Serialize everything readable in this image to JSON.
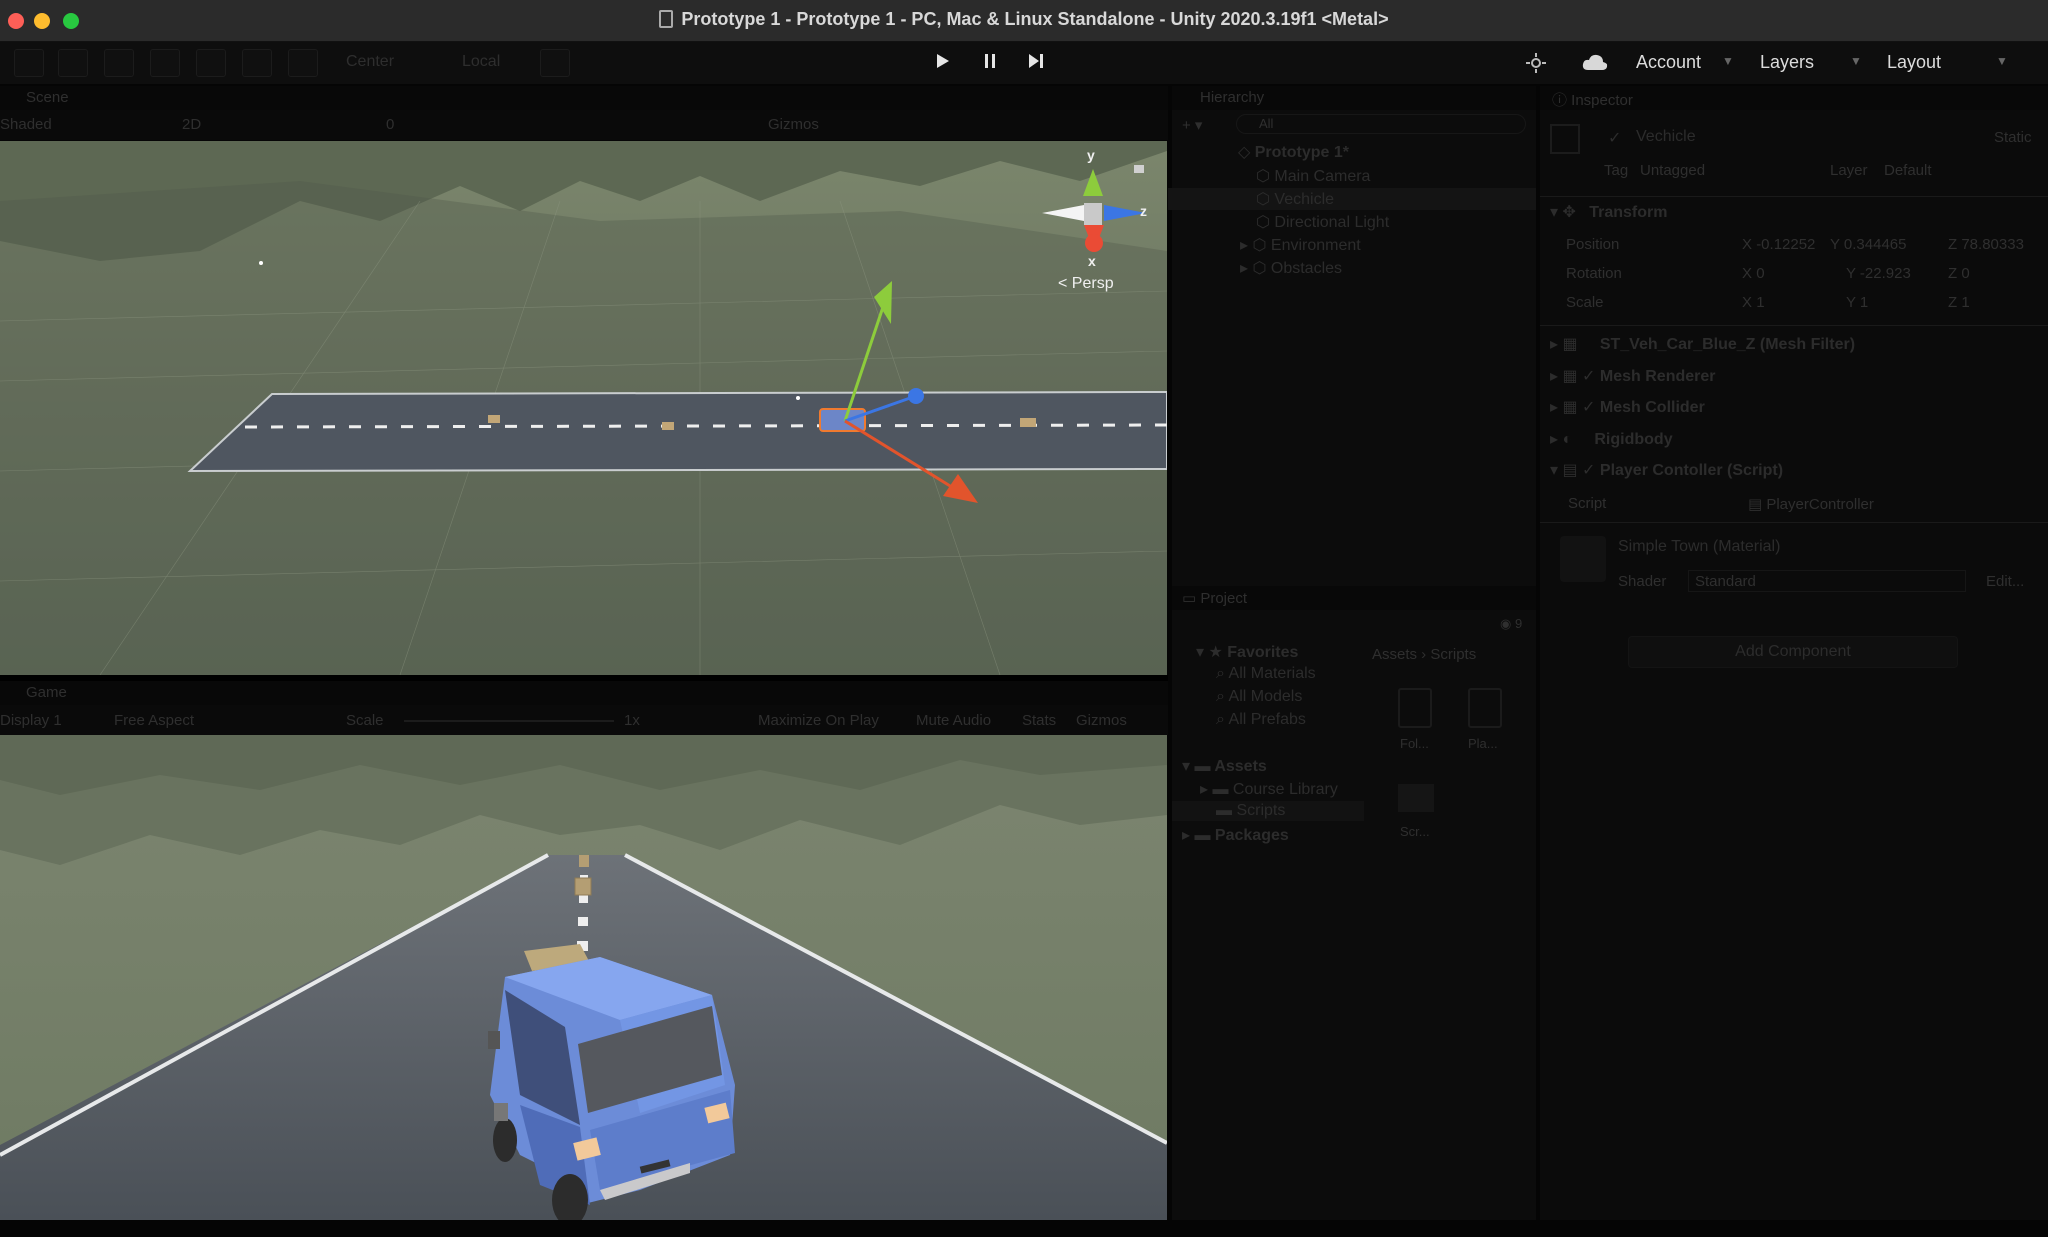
{
  "window": {
    "title": "Prototype 1 - Prototype 1 - PC, Mac & Linux Standalone - Unity 2020.3.19f1 <Metal>"
  },
  "toolbar": {
    "pivot": "Center",
    "space": "Local",
    "account": "Account",
    "layers": "Layers",
    "layout": "Layout"
  },
  "scene": {
    "tab": "Scene",
    "shading": "Shaded",
    "mode_2d": "2D",
    "gizmos": "Gizmos",
    "layer_count": "0",
    "persp": "Persp",
    "axes": {
      "y": "y",
      "x": "x",
      "z": "z"
    }
  },
  "game": {
    "tab": "Game",
    "display": "Display 1",
    "aspect": "Free Aspect",
    "scale_label": "Scale",
    "scale_value": "1x",
    "maximize": "Maximize On Play",
    "mute": "Mute Audio",
    "stats": "Stats",
    "gizmos": "Gizmos"
  },
  "hierarchy": {
    "tab": "Hierarchy",
    "search_placeholder": "All",
    "root": "Prototype 1*",
    "items": [
      "Main Camera",
      "Vechicle",
      "Directional Light",
      "Environment",
      "Obstacles"
    ]
  },
  "project": {
    "tab": "Project",
    "badge": "9",
    "favorites": "Favorites",
    "favorite_items": [
      "All Materials",
      "All Models",
      "All Prefabs"
    ],
    "assets": "Assets",
    "asset_items": [
      "Course Library",
      "Scripts"
    ],
    "packages": "Packages",
    "breadcrumb": [
      "Assets",
      "Scripts"
    ],
    "files": [
      "Fol...",
      "Pla...",
      "Scr..."
    ]
  },
  "inspector": {
    "tab": "Inspector",
    "object_name": "Vechicle",
    "static_label": "Static",
    "tag_label": "Tag",
    "tag_value": "Untagged",
    "layer_label": "Layer",
    "layer_value": "Default",
    "transform": "Transform",
    "position_label": "Position",
    "rotation_label": "Rotation",
    "scale_label": "Scale",
    "position": {
      "x": "-0.12252",
      "y": "0.344465",
      "z": "78.80333"
    },
    "rotation": {
      "x": "0",
      "y": "-22.923",
      "z": "0"
    },
    "scale": {
      "x": "1",
      "y": "1",
      "z": "1"
    },
    "components": [
      "ST_Veh_Car_Blue_Z (Mesh Filter)",
      "Mesh Renderer",
      "Mesh Collider",
      "Rigidbody",
      "Player Contoller (Script)"
    ],
    "script_label": "Script",
    "script_value": "PlayerController",
    "material_name": "Simple Town (Material)",
    "shader_label": "Shader",
    "shader_value": "Standard",
    "edit_button": "Edit...",
    "add_component": "Add Component"
  },
  "colors": {
    "close": "#fe5f57",
    "minimize": "#febc2e",
    "maximize": "#28c840",
    "sky": "#76806a",
    "road": "#4a525d",
    "car": "#6c8cd8"
  }
}
